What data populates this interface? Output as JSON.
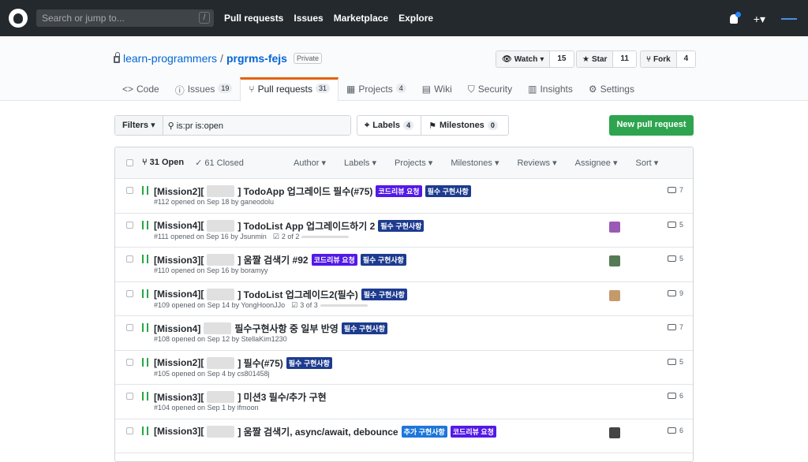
{
  "topbar": {
    "search_placeholder": "Search or jump to...",
    "search_hotkey": "/",
    "nav": [
      "Pull requests",
      "Issues",
      "Marketplace",
      "Explore"
    ],
    "plus_label": "+▾"
  },
  "repo": {
    "owner": "learn-programmers",
    "separator": "/",
    "name": "prgrms-fejs",
    "visibility": "Private",
    "watch": {
      "label": "Watch",
      "count": "15"
    },
    "star": {
      "label": "Star",
      "count": "11"
    },
    "fork": {
      "label": "Fork",
      "count": "4"
    }
  },
  "tabs": [
    {
      "label": "Code",
      "count": ""
    },
    {
      "label": "Issues",
      "count": "19"
    },
    {
      "label": "Pull requests",
      "count": "31"
    },
    {
      "label": "Projects",
      "count": "4"
    },
    {
      "label": "Wiki",
      "count": ""
    },
    {
      "label": "Security",
      "count": ""
    },
    {
      "label": "Insights",
      "count": ""
    },
    {
      "label": "Settings",
      "count": ""
    }
  ],
  "toolbar": {
    "filters_label": "Filters",
    "filter_query": "is:pr is:open",
    "labels_label": "Labels",
    "labels_count": "4",
    "milestones_label": "Milestones",
    "milestones_count": "0",
    "new_pr": "New pull request"
  },
  "list": {
    "open": "31 Open",
    "closed": "61 Closed",
    "menus": [
      "Author",
      "Labels",
      "Projects",
      "Milestones",
      "Reviews",
      "Assignee",
      "Sort"
    ]
  },
  "rows": [
    {
      "prefix": "[Mission2][",
      "suffix": "] TodoApp 업그레이드 필수(#75)",
      "labels": [
        "코드리뷰 요청",
        "필수 구현사항"
      ],
      "meta": "#112 opened on Sep 18 by ganeodolu",
      "progress": "",
      "comments": "7"
    },
    {
      "prefix": "[Mission4][",
      "suffix": "] TodoList App 업그레이드하기 2",
      "labels": [
        "필수 구현사항"
      ],
      "meta": "#111 opened on Sep 16 by Jsunmin",
      "progress": "2 of 2",
      "comments": "5"
    },
    {
      "prefix": "[Mission3][",
      "suffix": "] 움짤 검색기 #92",
      "labels": [
        "코드리뷰 요청",
        "필수 구현사항"
      ],
      "meta": "#110 opened on Sep 16 by boramyy",
      "progress": "",
      "comments": "5"
    },
    {
      "prefix": "[Mission4][",
      "suffix": "] TodoList 업그레이드2(필수)",
      "labels": [
        "필수 구현사항"
      ],
      "meta": "#109 opened on Sep 14 by YongHoonJJo",
      "progress": "3 of 3",
      "comments": "9"
    },
    {
      "prefix": "[Mission4] ",
      "suffix": "필수구현사항 중 일부 반영",
      "labels": [
        "필수 구현사항"
      ],
      "meta": "#108 opened on Sep 12 by StellaKim1230",
      "progress": "",
      "comments": "7"
    },
    {
      "prefix": "[Mission2][",
      "suffix": "] 필수(#75)",
      "labels": [
        "필수 구현사항"
      ],
      "meta": "#105 opened on Sep 4 by cs801458j",
      "progress": "",
      "comments": "5"
    },
    {
      "prefix": "[Mission3][",
      "suffix": "] 미션3 필수/추가 구현",
      "labels": [],
      "meta": "#104 opened on Sep 1 by ifmoon",
      "progress": "",
      "comments": "6"
    },
    {
      "prefix": "[Mission3][",
      "suffix": "] 움짤 검색기, async/await, debounce",
      "labels": [
        "추가 구현사항",
        "코드리뷰 요청"
      ],
      "meta": "",
      "progress": "",
      "comments": "6"
    }
  ]
}
